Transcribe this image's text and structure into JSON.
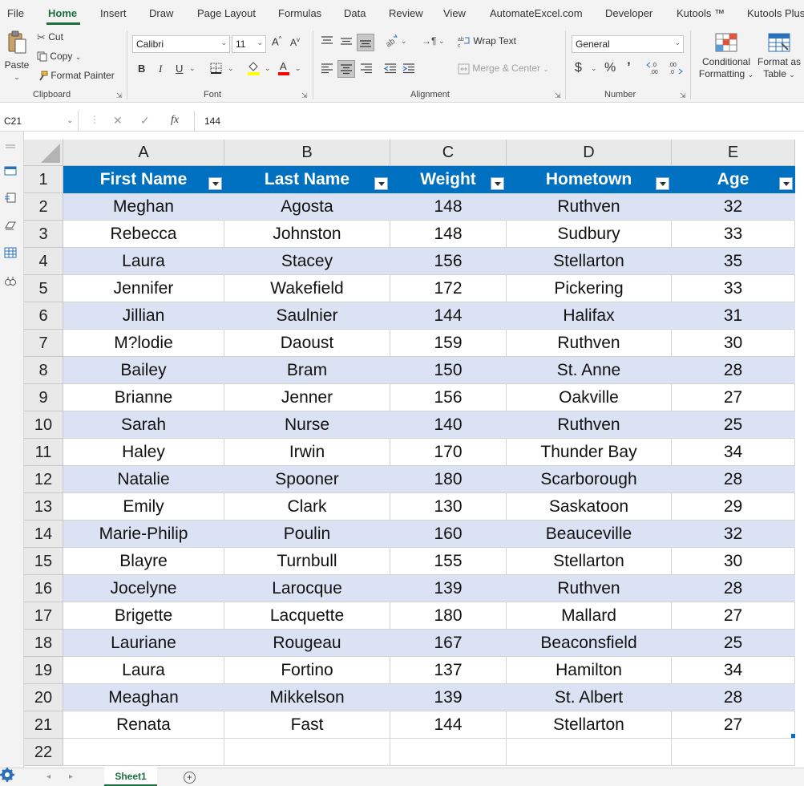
{
  "menu": {
    "tabs": [
      "File",
      "Home",
      "Insert",
      "Draw",
      "Page Layout",
      "Formulas",
      "Data",
      "Review",
      "View",
      "AutomateExcel.com",
      "Developer",
      "Kutools ™",
      "Kutools Plus"
    ],
    "active": "Home"
  },
  "ribbon": {
    "clipboard": {
      "label": "Clipboard",
      "paste": "Paste",
      "cut": "Cut",
      "copy": "Copy",
      "format_painter": "Format Painter"
    },
    "font": {
      "label": "Font",
      "family": "Calibri",
      "size": "11",
      "bold": "B",
      "italic": "I",
      "underline": "U"
    },
    "alignment": {
      "label": "Alignment",
      "wrap_text": "Wrap Text",
      "merge_center": "Merge & Center"
    },
    "number": {
      "label": "Number",
      "format": "General",
      "currency": "$",
      "percent": "%",
      "comma": "ʙ"
    },
    "styles": {
      "conditional_line1": "Conditional",
      "conditional_line2": "Formatting",
      "table_line1": "Format as",
      "table_line2": "Table"
    }
  },
  "formula_bar": {
    "name_box": "C21",
    "value": "144"
  },
  "grid": {
    "column_headers": [
      "A",
      "B",
      "C",
      "D",
      "E"
    ],
    "row_numbers": [
      "1",
      "2",
      "3",
      "4",
      "5",
      "6",
      "7",
      "8",
      "9",
      "10",
      "11",
      "12",
      "13",
      "14",
      "15",
      "16",
      "17",
      "18",
      "19",
      "20",
      "21",
      "22"
    ],
    "table_headers": [
      "First Name",
      "Last Name",
      "Weight",
      "Hometown",
      "Age"
    ],
    "rows": [
      [
        "Meghan",
        "Agosta",
        "148",
        "Ruthven",
        "32"
      ],
      [
        "Rebecca",
        "Johnston",
        "148",
        "Sudbury",
        "33"
      ],
      [
        "Laura",
        "Stacey",
        "156",
        "Stellarton",
        "35"
      ],
      [
        "Jennifer",
        "Wakefield",
        "172",
        "Pickering",
        "33"
      ],
      [
        "Jillian",
        "Saulnier",
        "144",
        "Halifax",
        "31"
      ],
      [
        "M?lodie",
        "Daoust",
        "159",
        "Ruthven",
        "30"
      ],
      [
        "Bailey",
        "Bram",
        "150",
        "St. Anne",
        "28"
      ],
      [
        "Brianne",
        "Jenner",
        "156",
        "Oakville",
        "27"
      ],
      [
        "Sarah",
        "Nurse",
        "140",
        "Ruthven",
        "25"
      ],
      [
        "Haley",
        "Irwin",
        "170",
        "Thunder Bay",
        "34"
      ],
      [
        "Natalie",
        "Spooner",
        "180",
        "Scarborough",
        "28"
      ],
      [
        "Emily",
        "Clark",
        "130",
        "Saskatoon",
        "29"
      ],
      [
        "Marie-Philip",
        "Poulin",
        "160",
        "Beauceville",
        "32"
      ],
      [
        "Blayre",
        "Turnbull",
        "155",
        "Stellarton",
        "30"
      ],
      [
        "Jocelyne",
        "Larocque",
        "139",
        "Ruthven",
        "28"
      ],
      [
        "Brigette",
        "Lacquette",
        "180",
        "Mallard",
        "27"
      ],
      [
        "Lauriane",
        "Rougeau",
        "167",
        "Beaconsfield",
        "25"
      ],
      [
        "Laura",
        "Fortino",
        "137",
        "Hamilton",
        "34"
      ],
      [
        "Meaghan",
        "Mikkelson",
        "139",
        "St. Albert",
        "28"
      ],
      [
        "Renata",
        "Fast",
        "144",
        "Stellarton",
        "27"
      ]
    ]
  },
  "sheets": {
    "tabs": [
      "Sheet1"
    ],
    "active": "Sheet1"
  },
  "colors": {
    "accent": "#1e6e3c",
    "table_header": "#0070c0",
    "band": "#dae2f3"
  }
}
